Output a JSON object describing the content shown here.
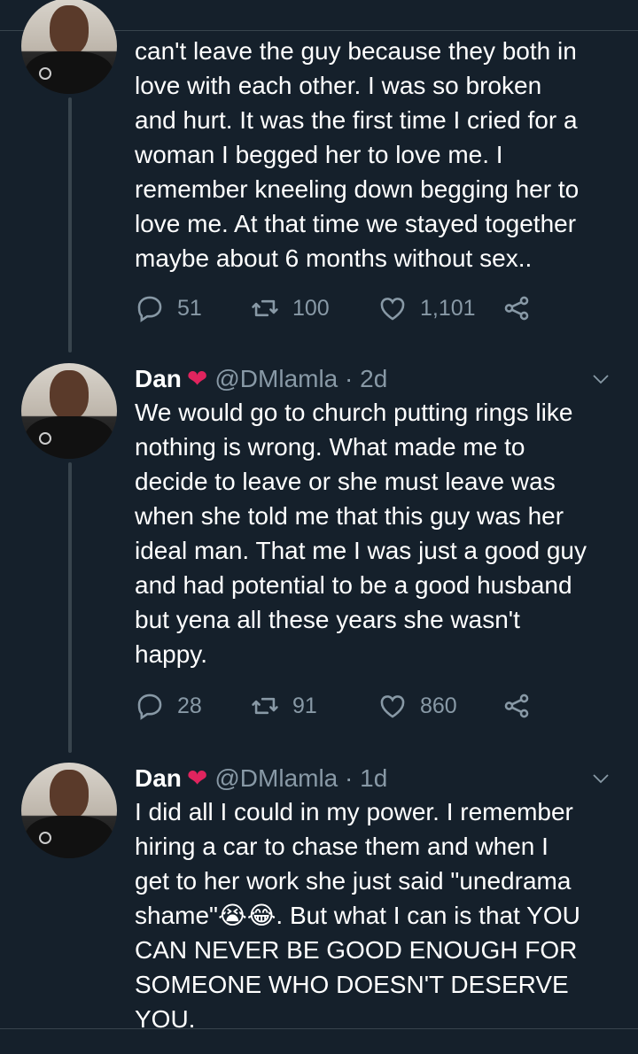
{
  "tweets": [
    {
      "name": "",
      "handle": "",
      "time": "",
      "text": "can't leave the guy because they both in\nlove with each other. I was so broken\nand hurt. It was the first time I cried for a\nwoman I begged her to love me. I\nremember kneeling down begging her to\nlove me. At that time we stayed together\nmaybe about 6 months without sex..",
      "replies": "51",
      "retweets": "100",
      "likes": "1,101"
    },
    {
      "name": "Dan",
      "handle": "@DMlamla · 2d",
      "text": "We would go to church putting rings like\nnothing is wrong. What made me to\ndecide to leave or she must leave was\nwhen she told me that this guy was her\nideal man. That me I was just a good guy\nand had potential to be a good husband\nbut yena all these years she wasn't\nhappy.",
      "replies": "28",
      "retweets": "91",
      "likes": "860"
    },
    {
      "name": "Dan",
      "handle": "@DMlamla · 1d",
      "text": "I did all I could in my power. I remember\nhiring a car to chase them and when I\nget to her work she just said \"unedrama\nshame\"😭😂. But what I can is that YOU\nCAN NEVER BE GOOD ENOUGH FOR\nSOMEONE WHO DOESN'T DESERVE\nYOU."
    }
  ],
  "colors": {
    "background": "#15202b",
    "secondary_text": "#8899a6",
    "heart": "#e0245e",
    "divider": "#38444d"
  },
  "icons": {
    "reply": "reply-icon",
    "retweet": "retweet-icon",
    "like": "like-icon",
    "share": "share-icon",
    "more": "chevron-down-icon"
  }
}
